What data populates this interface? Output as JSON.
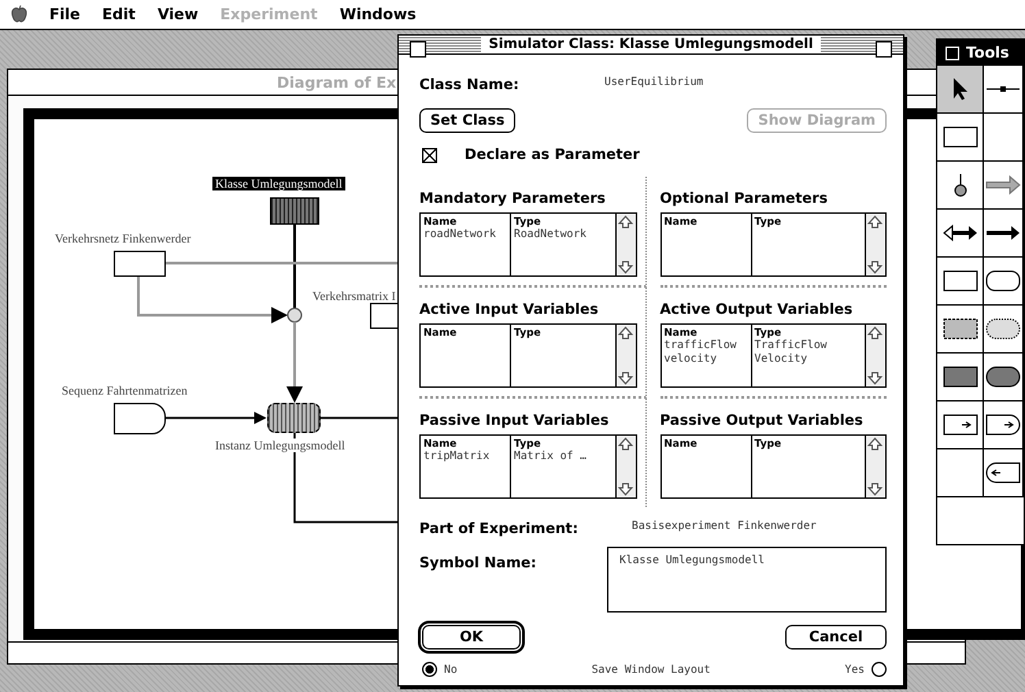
{
  "menu_bar": {
    "items": [
      {
        "label": "File",
        "disabled": false
      },
      {
        "label": "Edit",
        "disabled": false
      },
      {
        "label": "View",
        "disabled": false
      },
      {
        "label": "Experiment",
        "disabled": true
      },
      {
        "label": "Windows",
        "disabled": false
      }
    ]
  },
  "diagram_window": {
    "title": "Diagram of Ex",
    "nodes": [
      {
        "kind": "class",
        "label": "Klasse Umlegungsmodell",
        "selected": true
      },
      {
        "kind": "network",
        "label": "Verkehrsnetz Finkenwerder",
        "selected": false
      },
      {
        "kind": "matrix",
        "label": "Verkehrsmatrix I",
        "selected": false
      },
      {
        "kind": "sequence",
        "label": "Sequenz Fahrtenmatrizen",
        "selected": false
      },
      {
        "kind": "instance",
        "label": "Instanz Umlegungsmodell",
        "selected": false
      }
    ]
  },
  "dialog": {
    "title": "Simulator Class: Klasse Umlegungsmodell",
    "class_name_label": "Class Name:",
    "class_name": "UserEquilibrium",
    "set_class_button": {
      "label": "Set Class",
      "disabled": false
    },
    "show_diagram_button": {
      "label": "Show Diagram",
      "disabled": true
    },
    "declare_parameter": {
      "label": "Declare as Parameter",
      "checked": true
    },
    "panels": [
      {
        "title": "Mandatory Parameters",
        "columns": [
          "Name",
          "Type"
        ],
        "rows": [
          [
            "roadNetwork",
            "RoadNetwork"
          ]
        ]
      },
      {
        "title": "Optional Parameters",
        "columns": [
          "Name",
          "Type"
        ]
      },
      {
        "title": "Active Input Variables",
        "columns": [
          "Name",
          "Type"
        ]
      },
      {
        "title": "Active Output Variables",
        "columns": [
          "Name",
          "Type"
        ],
        "rows": [
          [
            "trafficFlow",
            "TrafficFlow"
          ],
          [
            "velocity",
            "Velocity"
          ]
        ]
      },
      {
        "title": "Passive Input Variables",
        "columns": [
          "Name",
          "Type"
        ],
        "rows": [
          [
            "tripMatrix",
            "Matrix of …"
          ]
        ]
      },
      {
        "title": "Passive Output Variables",
        "columns": [
          "Name",
          "Type"
        ]
      }
    ],
    "part_of_experiment_label": "Part of Experiment:",
    "part_of_experiment": "Basisexperiment Finkenwerder",
    "symbol_name_label": "Symbol Name:",
    "symbol_name": "Klasse Umlegungsmodell",
    "ok_button": "OK",
    "cancel_button": "Cancel",
    "save_layout": {
      "label": "Save Window Layout",
      "options": [
        {
          "label": "No",
          "selected": true
        },
        {
          "label": "Yes",
          "selected": false
        }
      ]
    }
  },
  "tools_palette": {
    "title": "Tools",
    "tools": [
      {
        "kind": "pointer",
        "selected": true
      },
      {
        "kind": "link",
        "selected": false
      },
      {
        "kind": "rect",
        "selected": false
      },
      {
        "kind": "empty",
        "selected": false
      },
      {
        "kind": "pin",
        "selected": false
      },
      {
        "kind": "grey-arrow",
        "selected": false
      },
      {
        "kind": "double-arrow",
        "selected": false
      },
      {
        "kind": "arrow",
        "selected": false
      },
      {
        "kind": "rect",
        "selected": false
      },
      {
        "kind": "rounded",
        "selected": false
      },
      {
        "kind": "hatched-rect",
        "selected": false
      },
      {
        "kind": "dotted-oval",
        "selected": false
      },
      {
        "kind": "dark-rect",
        "selected": false
      },
      {
        "kind": "dark-oval",
        "selected": false
      },
      {
        "kind": "input-rect",
        "selected": false
      },
      {
        "kind": "input-rounded",
        "selected": false
      },
      {
        "kind": "empty",
        "selected": false
      },
      {
        "kind": "output-rounded",
        "selected": false
      }
    ]
  }
}
